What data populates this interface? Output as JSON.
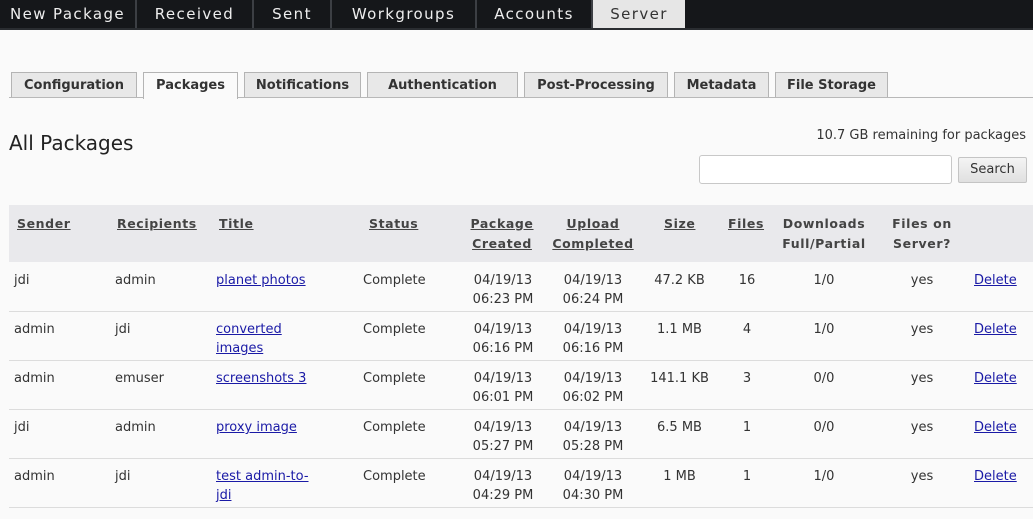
{
  "topnav": {
    "items": [
      {
        "label": "New Package",
        "active": false
      },
      {
        "label": "Received",
        "active": false
      },
      {
        "label": "Sent",
        "active": false
      },
      {
        "label": "Workgroups",
        "active": false
      },
      {
        "label": "Accounts",
        "active": false
      },
      {
        "label": "Server",
        "active": true
      }
    ]
  },
  "tabs": [
    {
      "label": "Configuration",
      "active": false
    },
    {
      "label": "Packages",
      "active": true
    },
    {
      "label": "Notifications",
      "active": false
    },
    {
      "label": "Authentication",
      "active": false
    },
    {
      "label": "Post-Processing",
      "active": false
    },
    {
      "label": "Metadata",
      "active": false
    },
    {
      "label": "File Storage",
      "active": false
    }
  ],
  "main": {
    "title": "All Packages",
    "remaining": "10.7 GB remaining for packages",
    "search": {
      "value": "",
      "placeholder": "",
      "button": "Search"
    }
  },
  "table": {
    "headers": {
      "sender": "Sender",
      "recipients": "Recipients",
      "title": "Title",
      "status": "Status",
      "created_1": "Package",
      "created_2": "Created",
      "upload_1": "Upload",
      "upload_2": "Completed",
      "size": "Size",
      "files": "Files",
      "downloads_1": "Downloads",
      "downloads_2": "Full/Partial",
      "onserver_1": "Files on",
      "onserver_2": "Server?"
    },
    "rows": [
      {
        "sender": "jdi",
        "recipients": "admin",
        "title_1": "planet photos",
        "title_2": "",
        "status": "Complete",
        "created_date": "04/19/13",
        "created_time": "06:23 PM",
        "upload_date": "04/19/13",
        "upload_time": "06:24 PM",
        "size": "47.2 KB",
        "files": "16",
        "downloads": "1/0",
        "on_server": "yes",
        "action": "Delete"
      },
      {
        "sender": "admin",
        "recipients": "jdi",
        "title_1": "converted",
        "title_2": "images",
        "status": "Complete",
        "created_date": "04/19/13",
        "created_time": "06:16 PM",
        "upload_date": "04/19/13",
        "upload_time": "06:16 PM",
        "size": "1.1 MB",
        "files": "4",
        "downloads": "1/0",
        "on_server": "yes",
        "action": "Delete"
      },
      {
        "sender": "admin",
        "recipients": "emuser",
        "title_1": "screenshots 3",
        "title_2": "",
        "status": "Complete",
        "created_date": "04/19/13",
        "created_time": "06:01 PM",
        "upload_date": "04/19/13",
        "upload_time": "06:02 PM",
        "size": "141.1 KB",
        "files": "3",
        "downloads": "0/0",
        "on_server": "yes",
        "action": "Delete"
      },
      {
        "sender": "jdi",
        "recipients": "admin",
        "title_1": "proxy image",
        "title_2": "",
        "status": "Complete",
        "created_date": "04/19/13",
        "created_time": "05:27 PM",
        "upload_date": "04/19/13",
        "upload_time": "05:28 PM",
        "size": "6.5 MB",
        "files": "1",
        "downloads": "0/0",
        "on_server": "yes",
        "action": "Delete"
      },
      {
        "sender": "admin",
        "recipients": "jdi",
        "title_1": "test admin-to-",
        "title_2": "jdi",
        "status": "Complete",
        "created_date": "04/19/13",
        "created_time": "04:29 PM",
        "upload_date": "04/19/13",
        "upload_time": "04:30 PM",
        "size": "1 MB",
        "files": "1",
        "downloads": "1/0",
        "on_server": "yes",
        "action": "Delete"
      }
    ]
  }
}
